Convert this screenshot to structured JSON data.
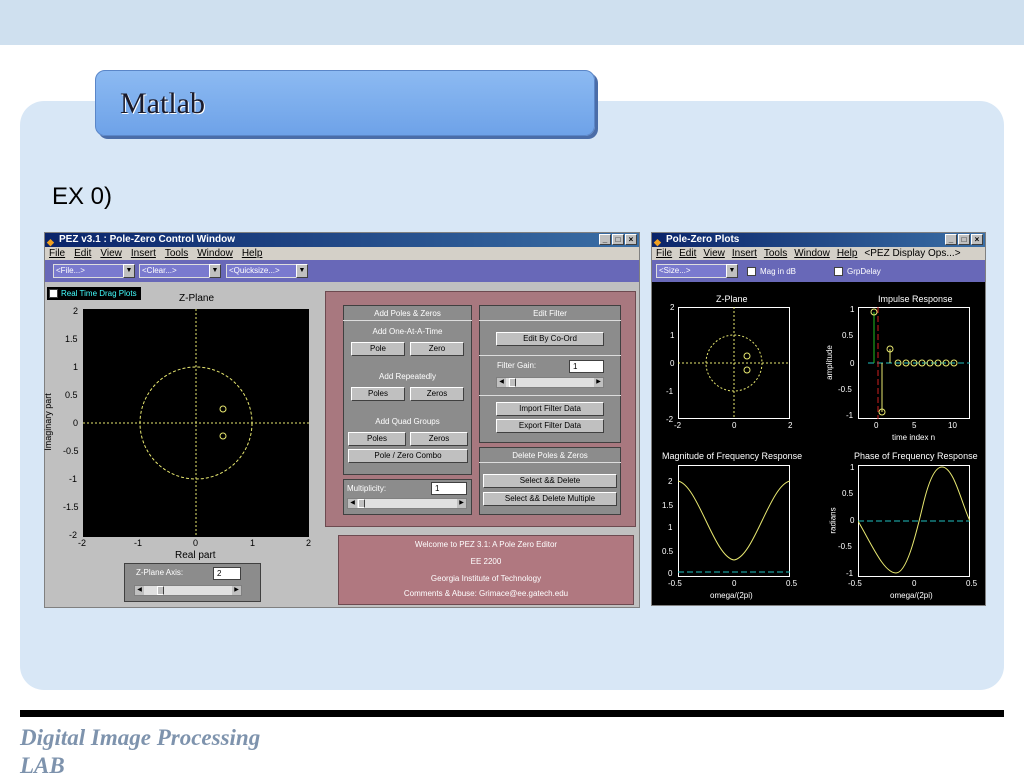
{
  "slide": {
    "title": "Matlab",
    "ex_label": "EX 0)",
    "footer_line1": "Digital Image Processing",
    "footer_line2": "LAB"
  },
  "control_window": {
    "title": "PEZ v3.1 : Pole-Zero Control Window",
    "menu": [
      "File",
      "Edit",
      "View",
      "Insert",
      "Tools",
      "Window",
      "Help"
    ],
    "dropdowns": [
      "<File...>",
      "<Clear...>",
      "<Quicksize...>"
    ],
    "realtime_label": "Real Time Drag Plots",
    "zplane": {
      "title": "Z-Plane",
      "xlabel": "Real part",
      "ylabel": "Imaginary part",
      "y_ticks": [
        "2",
        "1.5",
        "1",
        "0.5",
        "0",
        "-0.5",
        "-1",
        "-1.5",
        "-2"
      ],
      "x_ticks": [
        "-2",
        "-1",
        "0",
        "1",
        "2"
      ]
    },
    "axis_label": "Z-Plane Axis:",
    "axis_value": "2",
    "add_group": {
      "header": "Add Poles & Zeros",
      "one_at_a_time": "Add One-At-A-Time",
      "pole": "Pole",
      "zero": "Zero",
      "repeatedly": "Add Repeatedly",
      "poles": "Poles",
      "zeros": "Zeros",
      "quad": "Add Quad Groups",
      "quad_poles": "Poles",
      "quad_zeros": "Zeros",
      "combo": "Pole / Zero Combo"
    },
    "multiplicity_label": "Multiplicity:",
    "multiplicity_value": "1",
    "edit_group": {
      "header": "Edit Filter",
      "edit_coord": "Edit By Co-Ord",
      "gain_label": "Filter Gain:",
      "gain_value": "1",
      "import": "Import Filter Data",
      "export": "Export Filter Data"
    },
    "delete_group": {
      "header": "Delete Poles & Zeros",
      "select_delete": "Select && Delete",
      "select_delete_multiple": "Select && Delete Multiple"
    },
    "welcome": [
      "Welcome to PEZ 3.1: A Pole Zero Editor",
      "EE 2200",
      "Georgia Institute of Technology",
      "Comments & Abuse: Grimace@ee.gatech.edu"
    ]
  },
  "plots_window": {
    "title": "Pole-Zero Plots",
    "menu": [
      "File",
      "Edit",
      "View",
      "Insert",
      "Tools",
      "Window",
      "Help",
      "<PEZ Display Ops...>"
    ],
    "size_dd": "<Size...>",
    "mag_db": "Mag in dB",
    "grp_delay": "GrpDelay",
    "zplane": {
      "title": "Z-Plane",
      "y_ticks": [
        "2",
        "1",
        "0",
        "-1",
        "-2"
      ],
      "x_ticks": [
        "-2",
        "0",
        "2"
      ]
    },
    "impulse": {
      "title": "Impulse Response",
      "ylabel": "amplitude",
      "xlabel": "time index n",
      "y_ticks": [
        "1",
        "0.5",
        "0",
        "-0.5",
        "-1"
      ],
      "x_ticks": [
        "0",
        "5",
        "10"
      ]
    },
    "magnitude": {
      "title": "Magnitude of Frequency Response",
      "xlabel": "omega/(2pi)",
      "y_ticks": [
        "2",
        "1.5",
        "1",
        "0.5",
        "0"
      ],
      "x_ticks": [
        "-0.5",
        "0",
        "0.5"
      ]
    },
    "phase": {
      "title": "Phase of Frequency Response",
      "xlabel": "omega/(2pi)",
      "ylabel": "radians",
      "y_ticks": [
        "1",
        "0.5",
        "0",
        "-0.5",
        "-1"
      ],
      "x_ticks": [
        "-0.5",
        "0",
        "0.5"
      ]
    }
  }
}
